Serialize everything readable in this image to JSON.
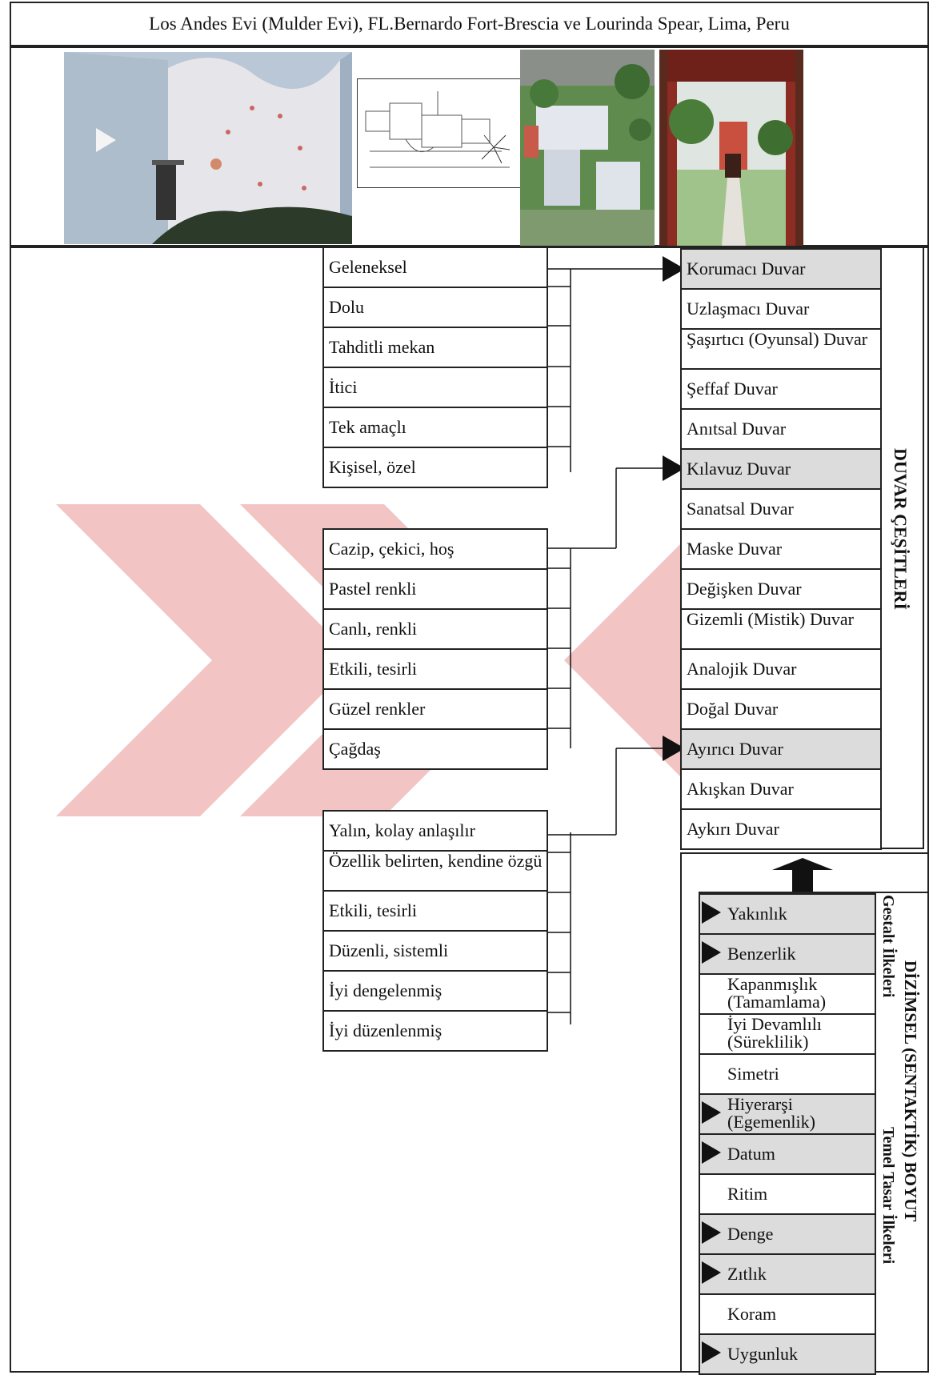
{
  "title": "Los Andes Evi (Mulder Evi), FL.Bernardo Fort-Brescia ve Lourinda Spear, Lima, Peru",
  "groups": [
    {
      "items": [
        "Geleneksel",
        "Dolu",
        "Tahditli mekan",
        "İtici",
        "Tek amaçlı",
        "Kişisel, özel"
      ]
    },
    {
      "items": [
        "Cazip, çekici, hoş",
        "Pastel renkli",
        "Canlı, renkli",
        "Etkili, tesirli",
        "Güzel renkler",
        "Çağdaş"
      ]
    },
    {
      "items": [
        "Yalın, kolay anlaşılır",
        "Özellik belirten, kendine özgü",
        "Etkili, tesirli",
        "Düzenli, sistemli",
        "İyi dengelenmiş",
        "İyi düzenlenmiş"
      ]
    }
  ],
  "wall_types": {
    "heading": "DUVAR ÇEŞİTLERİ",
    "items": [
      {
        "label": "Korumacı Duvar",
        "highlighted": true
      },
      {
        "label": "Uzlaşmacı Duvar",
        "highlighted": false
      },
      {
        "label": "Şaşırtıcı (Oyunsal) Duvar",
        "highlighted": false
      },
      {
        "label": "Şeffaf Duvar",
        "highlighted": false
      },
      {
        "label": "Anıtsal Duvar",
        "highlighted": false
      },
      {
        "label": "Kılavuz Duvar",
        "highlighted": true
      },
      {
        "label": "Sanatsal Duvar",
        "highlighted": false
      },
      {
        "label": "Maske Duvar",
        "highlighted": false
      },
      {
        "label": "Değişken Duvar",
        "highlighted": false
      },
      {
        "label": "Gizemli (Mistik) Duvar",
        "highlighted": false
      },
      {
        "label": "Analojik Duvar",
        "highlighted": false
      },
      {
        "label": "Doğal Duvar",
        "highlighted": false
      },
      {
        "label": "Ayırıcı Duvar",
        "highlighted": true
      },
      {
        "label": "Akışkan Duvar",
        "highlighted": false
      },
      {
        "label": "Aykırı Duvar",
        "highlighted": false
      }
    ]
  },
  "syntactic": {
    "heading": "DİZİMSEL (SENTAKTİK) BOYUT",
    "gestalt_label": "Gestalt İlkeleri",
    "design_label": "Temel Tasar İlkeleri",
    "items": [
      {
        "label": "Yakınlık",
        "highlighted": true
      },
      {
        "label": "Benzerlik",
        "highlighted": true
      },
      {
        "label": "Kapanmışlık (Tamamlama)",
        "highlighted": false
      },
      {
        "label": "İyi Devamlılı (Süreklilik)",
        "highlighted": false
      },
      {
        "label": "Simetri",
        "highlighted": false
      },
      {
        "label": "Hiyerarşi (Egemenlik)",
        "highlighted": true
      },
      {
        "label": "Datum",
        "highlighted": true
      },
      {
        "label": "Ritim",
        "highlighted": false
      },
      {
        "label": "Denge",
        "highlighted": true
      },
      {
        "label": "Zıtlık",
        "highlighted": true
      },
      {
        "label": "Koram",
        "highlighted": false
      },
      {
        "label": "Uygunluk",
        "highlighted": true
      }
    ]
  },
  "colors": {
    "highlight": "#dcdcdc",
    "watermark": "#f2c4c4",
    "border": "#222222"
  }
}
